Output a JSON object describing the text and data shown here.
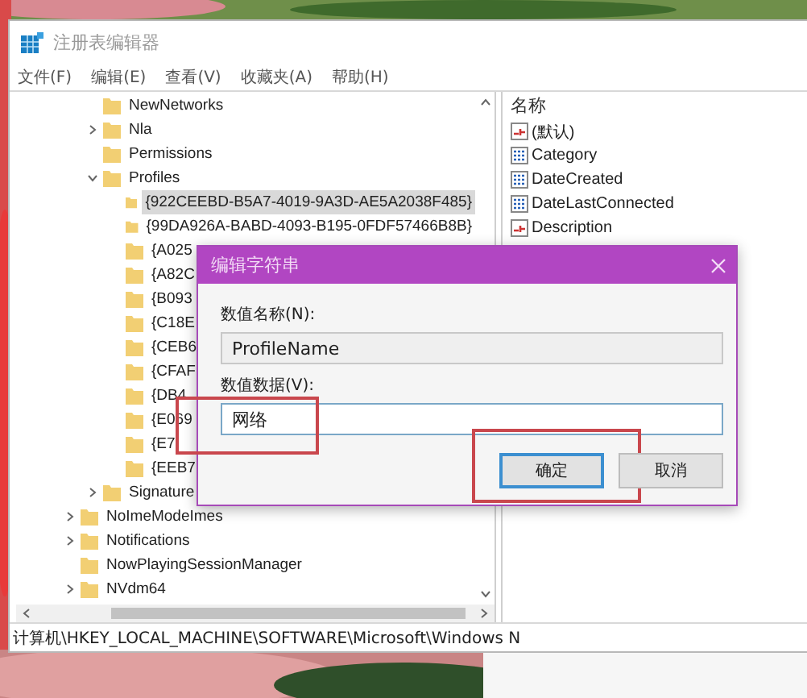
{
  "window": {
    "title": "注册表编辑器",
    "active": false
  },
  "menu": [
    "文件(F)",
    "编辑(E)",
    "查看(V)",
    "收藏夹(A)",
    "帮助(H)"
  ],
  "tree": [
    {
      "children": [
        {
          "label": "NewNetworks",
          "selected": false
        },
        {
          "label": "Nla",
          "expanded": false,
          "selected": false
        },
        {
          "label": "Permissions",
          "selected": false
        },
        {
          "label": "Profiles",
          "expanded": true,
          "selected": false,
          "children": [
            {
              "label": "{922CEEBD-B5A7-4019-9A3D-AE5A2038F485}",
              "selected": true
            },
            {
              "label": "{99DA926A-BABD-4093-B195-0FDF57466B8B}",
              "selected": false
            },
            {
              "label": "{A025",
              "selected": false
            },
            {
              "label": "{A82C",
              "selected": false
            },
            {
              "label": "{B093",
              "selected": false
            },
            {
              "label": "{C18E",
              "selected": false
            },
            {
              "label": "{CEB6",
              "selected": false
            },
            {
              "label": "{CFAF",
              "selected": false
            },
            {
              "label": "{DB4",
              "selected": false
            },
            {
              "label": "{E069",
              "selected": false
            },
            {
              "label": "{E7",
              "selected": false
            },
            {
              "label": "{EEB7",
              "selected": false
            }
          ]
        },
        {
          "label": "Signature",
          "expanded": false,
          "selected": false
        }
      ]
    },
    {
      "label": "NoImeModeImes",
      "expanded": false,
      "selected": false
    },
    {
      "label": "Notifications",
      "expanded": false,
      "selected": false
    },
    {
      "label": "NowPlayingSessionManager",
      "selected": false
    },
    {
      "label": "NVdm64",
      "expanded": false,
      "selected": false
    }
  ],
  "values": {
    "column": "名称",
    "rows": [
      {
        "kind": "string",
        "name": "(默认)"
      },
      {
        "kind": "binary",
        "name": "Category"
      },
      {
        "kind": "binary",
        "name": "DateCreated"
      },
      {
        "kind": "binary",
        "name": "DateLastConnected"
      },
      {
        "kind": "string",
        "name": "Description"
      }
    ]
  },
  "status_bar": "计算机\\HKEY_LOCAL_MACHINE\\SOFTWARE\\Microsoft\\Windows N",
  "dialog": {
    "title": "编辑字符串",
    "fields": [
      {
        "label": "数值名称(N):",
        "value": "ProfileName",
        "readonly": true,
        "highlighted": false
      },
      {
        "label": "数值数据(V):",
        "value": "网络",
        "readonly": false,
        "highlighted": true
      }
    ],
    "buttons": [
      {
        "label": "确定",
        "default": true,
        "highlighted": true
      },
      {
        "label": "取消",
        "default": false,
        "highlighted": false
      }
    ]
  }
}
